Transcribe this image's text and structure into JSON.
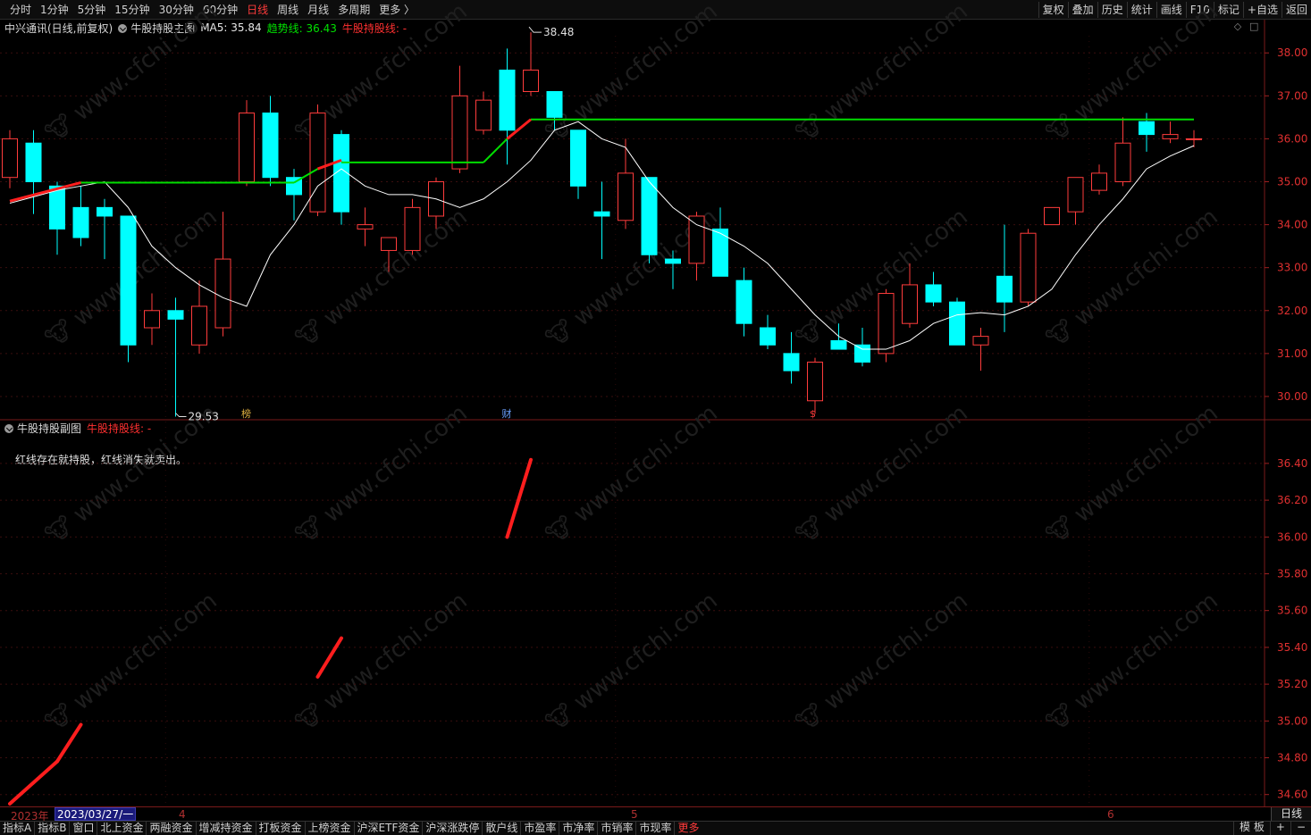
{
  "periods": [
    "分时",
    "1分钟",
    "5分钟",
    "15分钟",
    "30分钟",
    "60分钟",
    "日线",
    "周线",
    "月线",
    "多周期",
    "更多 〉"
  ],
  "active_period": "日线",
  "toolbar_right": [
    "复权",
    "叠加",
    "历史",
    "统计",
    "画线",
    "F10",
    "标记",
    "+自选",
    "返回"
  ],
  "main_header": {
    "stock": "中兴通讯(日线,前复权)",
    "indicator": "牛股持股主图",
    "ma5": "MA5: 35.84",
    "trend": "趋势线: 36.43",
    "bull": "牛股持股线: -"
  },
  "sub_header": {
    "indicator": "牛股持股副图",
    "bull": "牛股持股线: -",
    "note": "红线存在就持股，红线消失就卖出。"
  },
  "xaxis": {
    "year": "2023年",
    "date": "2023/03/27/一",
    "months": [
      "4",
      "5",
      "6"
    ],
    "period": "日线"
  },
  "bottom_tabs": [
    "指标A",
    "指标B",
    "窗口",
    "北上资金",
    "两融资金",
    "增减持资金",
    "打板资金",
    "上榜资金",
    "沪深ETF资金",
    "沪深涨跌停",
    "散户线",
    "市盈率",
    "市净率",
    "市销率",
    "市现率",
    "更多"
  ],
  "bottom_right": [
    "模 板",
    "+",
    "−"
  ],
  "colors": {
    "up": "#ff3c3c",
    "down": "#00ffff",
    "trend": "#00dd00",
    "bull": "#ff1e1e",
    "ma5": "#ffffff"
  },
  "markers": [
    {
      "label": "榜",
      "candle": 10,
      "color": "#e0b040"
    },
    {
      "label": "财",
      "candle": 21,
      "color": "#6aa0ff"
    },
    {
      "label": "$",
      "candle": 34,
      "color": "#ff3c3c"
    }
  ],
  "extremes": {
    "high_label": "38.48",
    "low_label": "29.53"
  },
  "chart_data": [
    {
      "type": "candlestick",
      "name": "main",
      "ylim": [
        29.5,
        38.4
      ],
      "yticks": [
        30.0,
        31.0,
        32.0,
        33.0,
        34.0,
        35.0,
        36.0,
        37.0,
        38.0
      ],
      "ohlc": [
        [
          35.1,
          36.2,
          34.85,
          36.0
        ],
        [
          35.9,
          36.2,
          34.25,
          35.0
        ],
        [
          34.9,
          35.0,
          33.3,
          33.9
        ],
        [
          34.4,
          34.9,
          33.5,
          33.7
        ],
        [
          34.4,
          34.6,
          33.2,
          34.2
        ],
        [
          34.2,
          34.2,
          30.8,
          31.2
        ],
        [
          31.6,
          32.4,
          31.2,
          32.0
        ],
        [
          32.0,
          32.3,
          29.53,
          31.8
        ],
        [
          31.2,
          32.7,
          31.0,
          32.1
        ],
        [
          31.6,
          34.3,
          31.4,
          33.2
        ],
        [
          35.0,
          36.9,
          34.9,
          36.6
        ],
        [
          36.6,
          37.0,
          34.9,
          35.1
        ],
        [
          35.1,
          35.3,
          34.1,
          34.7
        ],
        [
          34.3,
          36.8,
          34.2,
          36.6
        ],
        [
          36.1,
          36.2,
          34.0,
          34.3
        ],
        [
          33.9,
          34.4,
          33.5,
          34.0
        ],
        [
          33.4,
          33.6,
          32.9,
          33.7
        ],
        [
          33.4,
          34.6,
          33.3,
          34.4
        ],
        [
          34.2,
          35.1,
          33.9,
          35.0
        ],
        [
          35.3,
          37.7,
          35.2,
          37.0
        ],
        [
          36.2,
          37.1,
          36.1,
          36.9
        ],
        [
          37.6,
          38.1,
          35.4,
          36.2
        ],
        [
          37.1,
          38.48,
          37.0,
          37.6
        ],
        [
          37.1,
          37.1,
          36.2,
          36.5
        ],
        [
          36.2,
          36.2,
          34.6,
          34.9
        ],
        [
          34.3,
          35.0,
          33.2,
          34.2
        ],
        [
          34.1,
          36.0,
          33.9,
          35.2
        ],
        [
          35.1,
          35.1,
          33.1,
          33.3
        ],
        [
          33.2,
          33.4,
          32.5,
          33.1
        ],
        [
          33.1,
          34.3,
          32.7,
          34.2
        ],
        [
          33.9,
          34.4,
          32.8,
          32.8
        ],
        [
          32.7,
          33.0,
          31.4,
          31.7
        ],
        [
          31.6,
          31.9,
          31.1,
          31.2
        ],
        [
          31.0,
          31.5,
          30.3,
          30.6
        ],
        [
          29.9,
          30.9,
          29.6,
          30.8
        ],
        [
          31.3,
          31.7,
          31.1,
          31.1
        ],
        [
          31.2,
          31.6,
          30.7,
          30.8
        ],
        [
          31.0,
          32.5,
          30.8,
          32.4
        ],
        [
          31.7,
          33.1,
          31.6,
          32.6
        ],
        [
          32.6,
          32.9,
          32.1,
          32.2
        ],
        [
          32.2,
          32.3,
          31.2,
          31.2
        ],
        [
          31.2,
          31.6,
          30.6,
          31.4
        ],
        [
          32.8,
          34.0,
          31.5,
          32.2
        ],
        [
          32.2,
          33.9,
          32.1,
          33.8
        ],
        [
          34.0,
          34.3,
          34.0,
          34.4
        ],
        [
          34.3,
          35.1,
          34.0,
          35.1
        ],
        [
          34.8,
          35.4,
          34.7,
          35.2
        ],
        [
          35.0,
          36.5,
          34.9,
          35.9
        ],
        [
          36.4,
          36.6,
          35.7,
          36.1
        ],
        [
          36.0,
          36.4,
          35.9,
          36.1
        ],
        [
          36.0,
          36.2,
          35.8,
          36.0
        ]
      ],
      "ma5": [
        34.5,
        34.65,
        34.8,
        34.9,
        35.0,
        34.4,
        33.5,
        33.0,
        32.6,
        32.3,
        32.1,
        33.3,
        34.0,
        34.9,
        35.3,
        34.9,
        34.7,
        34.7,
        34.6,
        34.4,
        34.6,
        35.0,
        35.5,
        36.2,
        36.4,
        36.0,
        35.8,
        35.0,
        34.4,
        34.0,
        33.8,
        33.5,
        33.1,
        32.5,
        31.9,
        31.4,
        31.1,
        31.1,
        31.3,
        31.7,
        31.9,
        31.95,
        31.9,
        32.1,
        32.5,
        33.3,
        34.0,
        34.6,
        35.3,
        35.6,
        35.84
      ],
      "trend": {
        "segments": [
          {
            "from": 3,
            "to": 12,
            "values": [
              34.98,
              34.98
            ]
          },
          {
            "from": 12,
            "to": 13,
            "values": [
              34.98,
              35.3
            ]
          },
          {
            "from": 13,
            "to": 14,
            "values": [
              35.3,
              35.5
            ]
          },
          {
            "from": 14,
            "to": 20,
            "values": [
              35.45,
              35.45
            ]
          },
          {
            "from": 20,
            "to": 21,
            "values": [
              35.45,
              36.0
            ]
          },
          {
            "from": 21,
            "to": 22,
            "values": [
              36.0,
              36.45
            ]
          },
          {
            "from": 22,
            "to": 50,
            "values": [
              36.45,
              36.45
            ]
          }
        ]
      },
      "bull_segments": [
        {
          "from": 0,
          "to": 3,
          "values": [
            34.55,
            34.98
          ]
        },
        {
          "from": 13,
          "to": 14,
          "values": [
            35.3,
            35.5
          ]
        },
        {
          "from": 21,
          "to": 22,
          "values": [
            36.0,
            36.45
          ]
        }
      ]
    },
    {
      "type": "line",
      "name": "sub",
      "ylim": [
        34.55,
        36.55
      ],
      "yticks": [
        34.6,
        34.8,
        35.0,
        35.2,
        35.4,
        35.6,
        35.8,
        36.0,
        36.2,
        36.4
      ],
      "bull_segments": [
        {
          "from": 0,
          "to": 2,
          "values": [
            34.55,
            34.78
          ]
        },
        {
          "from": 2,
          "to": 3,
          "values": [
            34.78,
            34.98
          ]
        },
        {
          "from": 13,
          "to": 14,
          "values": [
            35.24,
            35.45
          ]
        },
        {
          "from": 21,
          "to": 22,
          "values": [
            36.0,
            36.42
          ]
        }
      ]
    }
  ]
}
